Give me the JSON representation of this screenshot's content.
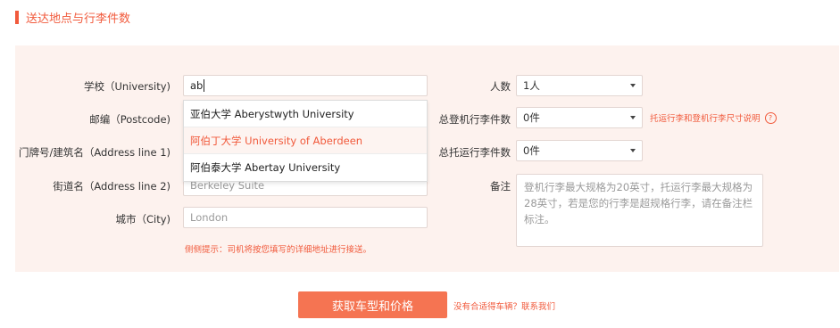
{
  "section": {
    "title": "送达地点与行李件数"
  },
  "form": {
    "school": {
      "label": "学校（University)",
      "value": "ab"
    },
    "postcode": {
      "label": "邮编（Postcode)"
    },
    "address1": {
      "label": "门牌号/建筑名（Address line 1)"
    },
    "address2": {
      "label": "街道名（Address line 2)",
      "placeholder": "Berkeley Suite"
    },
    "city": {
      "label": "城市（City)",
      "placeholder": "London"
    },
    "tip": "侧侧提示：司机将按您填写的详细地址进行接送。"
  },
  "suggestions": [
    {
      "text": "亚伯大学 Aberystwyth University",
      "highlighted": false
    },
    {
      "text": "阿伯丁大学 University of Aberdeen",
      "highlighted": true
    },
    {
      "text": "阿伯泰大学 Abertay University",
      "highlighted": false
    }
  ],
  "right": {
    "people": {
      "label": "人数",
      "value": "1人"
    },
    "carry_on": {
      "label": "总登机行李件数",
      "value": "0件"
    },
    "checked": {
      "label": "总托运行李件数",
      "value": "0件"
    },
    "size_link": "托运行李和登机行李尺寸说明",
    "remark": {
      "label": "备注",
      "placeholder": "登机行李最大规格为20英寸，托运行李最大规格为28英寸，若是您的行李是超规格行李，请在备注栏标注。"
    }
  },
  "actions": {
    "submit_label": "获取车型和价格",
    "contact_text": "没有合适得车辆？联系我们"
  },
  "colors": {
    "accent": "#f15a3c",
    "panel_bg": "#fdf2ee",
    "button_bg": "#f57452"
  },
  "icons": {
    "help": "question-circle-icon",
    "dropdown": "chevron-down-icon"
  }
}
